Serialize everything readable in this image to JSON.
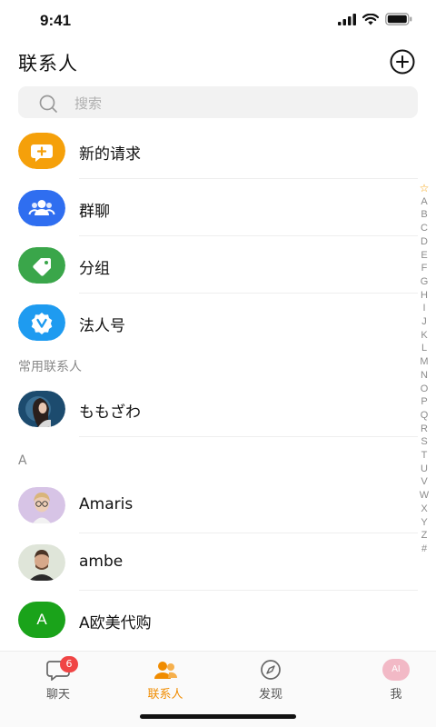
{
  "status": {
    "time": "9:41"
  },
  "header": {
    "title": "联系人"
  },
  "search": {
    "placeholder": "搜索"
  },
  "features": [
    {
      "label": "新的请求",
      "icon": "chat-plus-icon",
      "color": "#f5a00a"
    },
    {
      "label": "群聊",
      "icon": "group-icon",
      "color": "#2f6ef0"
    },
    {
      "label": "分组",
      "icon": "tag-icon",
      "color": "#3aa64a"
    },
    {
      "label": "法人号",
      "icon": "verified-badge-icon",
      "color": "#1e9bf0"
    }
  ],
  "sections": {
    "frequent": "常用联系人",
    "a": "A"
  },
  "frequent_contacts": [
    {
      "name": "ももざわ",
      "avatar": "photo-avatar"
    }
  ],
  "contacts_a": [
    {
      "name": "Amaris",
      "avatar": "photo-avatar"
    },
    {
      "name": "ambe",
      "avatar": "photo-avatar"
    },
    {
      "name": "A欧美代购",
      "avatar": "letter-avatar",
      "letter": "A",
      "color": "#1aa31a"
    }
  ],
  "alpha_index": [
    "☆",
    "A",
    "B",
    "C",
    "D",
    "E",
    "F",
    "G",
    "H",
    "I",
    "J",
    "K",
    "L",
    "M",
    "N",
    "O",
    "P",
    "Q",
    "R",
    "S",
    "T",
    "U",
    "V",
    "W",
    "X",
    "Y",
    "Z",
    "#"
  ],
  "tabs": [
    {
      "label": "聊天",
      "icon": "chat-icon",
      "badge": "6"
    },
    {
      "label": "联系人",
      "icon": "contacts-icon",
      "active": true
    },
    {
      "label": "发现",
      "icon": "compass-icon"
    },
    {
      "label": "我",
      "icon": "profile-avatar",
      "avatar_text": "AI"
    }
  ],
  "colors": {
    "accent": "#f08c00",
    "badge": "#f04545"
  }
}
